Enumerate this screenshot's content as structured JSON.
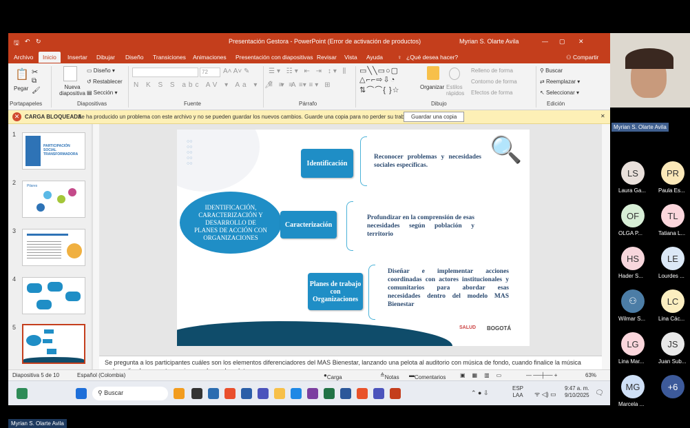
{
  "window": {
    "title": "Presentación Gestora - PowerPoint (Error de activación de productos)",
    "user": "Myrian S. Olarte Avila"
  },
  "menu": [
    "Archivo",
    "Inicio",
    "Insertar",
    "Dibujar",
    "Diseño",
    "Transiciones",
    "Animaciones",
    "Presentación con diapositivas",
    "Revisar",
    "Vista",
    "Ayuda"
  ],
  "tell_me": "¿Qué desea hacer?",
  "share_label": "Compartir",
  "ribbon": {
    "groups": [
      "Portapapeles",
      "Diapositivas",
      "Fuente",
      "Párrafo",
      "Dibujo",
      "Edición"
    ],
    "paste": "Pegar",
    "new_slide": "Nueva diapositiva",
    "layout": "Diseño",
    "reset": "Restablecer",
    "section": "Sección",
    "font_size": "72",
    "organize": "Organizar",
    "styles": "Estilos rápidos",
    "fill": "Relleno de forma",
    "outline": "Contorno de forma",
    "effects": "Efectos de forma",
    "find": "Buscar",
    "replace": "Reemplazar",
    "select": "Seleccionar"
  },
  "message_bar": {
    "title": "CARGA BLOQUEADA",
    "text": "Se ha producido un problema con este archivo y no se pueden guardar los nuevos cambios. Guarde una copia para no perder su trabajo.",
    "button": "Guardar una copia"
  },
  "thumbnails": [
    {
      "num": "1",
      "caption": "PARTICIPACIÓN SOCIAL TRANSFORMADORA"
    },
    {
      "num": "2",
      "caption": "Pilares"
    },
    {
      "num": "3",
      "caption": ""
    },
    {
      "num": "4",
      "caption": ""
    },
    {
      "num": "5",
      "caption": ""
    }
  ],
  "slide": {
    "circle": "IDENTIFICACIÓN, CARACTERIZACIÓN Y DESARROLLO DE PLANES DE ACCIÓN CON ORGANIZACIONES",
    "boxes": [
      {
        "label": "Identificación",
        "desc": "Reconocer problemas y necesidades sociales específicas."
      },
      {
        "label": "Caracterización",
        "desc": "Profundizar en la comprensión de esas necesidades según población y territorio"
      },
      {
        "label": "Planes de trabajo con Organizaciones",
        "desc": "Diseñar e implementar acciones coordinadas con actores institucionales y comunitarios para abordar esas necesidades dentro del modelo MAS Bienestar"
      }
    ],
    "footer_logo": "BOGOTÁ",
    "footer_salud": "SALUD"
  },
  "notes": "Se pregunta a los participantes cuáles son los elementos diferenciadores del MAS Bienestar, lanzando una pelota al auditorio con música de fondo, cuando finalice la música se le realiza la pregunta a quien quede con la pelota",
  "status": {
    "slide": "Diapositiva 5 de 10",
    "language": "Español (Colombia)",
    "blocked": "Carga bloqueada",
    "notes": "Notas",
    "comments": "Comentarios",
    "zoom": "63%"
  },
  "taskbar": {
    "search": "Buscar",
    "lang": "ESP",
    "lang2": "LAA",
    "time": "9:47 a. m.",
    "date": "9/10/2025"
  },
  "participants": [
    {
      "initials": "LS",
      "name": "Laura Ga...",
      "color": "#e9e0db"
    },
    {
      "initials": "PR",
      "name": "Paula Es...",
      "color": "#fbe8b8"
    },
    {
      "initials": "OF",
      "name": "OLGA P...",
      "color": "#d7eed6"
    },
    {
      "initials": "TL",
      "name": "Tatiana L...",
      "color": "#fbd6dc"
    },
    {
      "initials": "HS",
      "name": "Hader S...",
      "color": "#f7d6dc"
    },
    {
      "initials": "LE",
      "name": "Lourdes ...",
      "color": "#dbe8f6"
    },
    {
      "initials": "",
      "name": "Wilmar S...",
      "color": "#4c7da6"
    },
    {
      "initials": "LC",
      "name": "Lina Các...",
      "color": "#fbeec0"
    },
    {
      "initials": "LG",
      "name": "Lina Mar...",
      "color": "#fbd6dc"
    },
    {
      "initials": "JS",
      "name": "Juan Sub...",
      "color": "#e8e8e8"
    },
    {
      "initials": "MG",
      "name": "Marcela ...",
      "color": "#cfe0f6"
    },
    {
      "initials": "+6",
      "name": "",
      "color": "#3d5a9a"
    }
  ],
  "presenter_name": "Myrian S. Olarte Avila",
  "bottom_label": "Myrian S. Olarte Avila"
}
